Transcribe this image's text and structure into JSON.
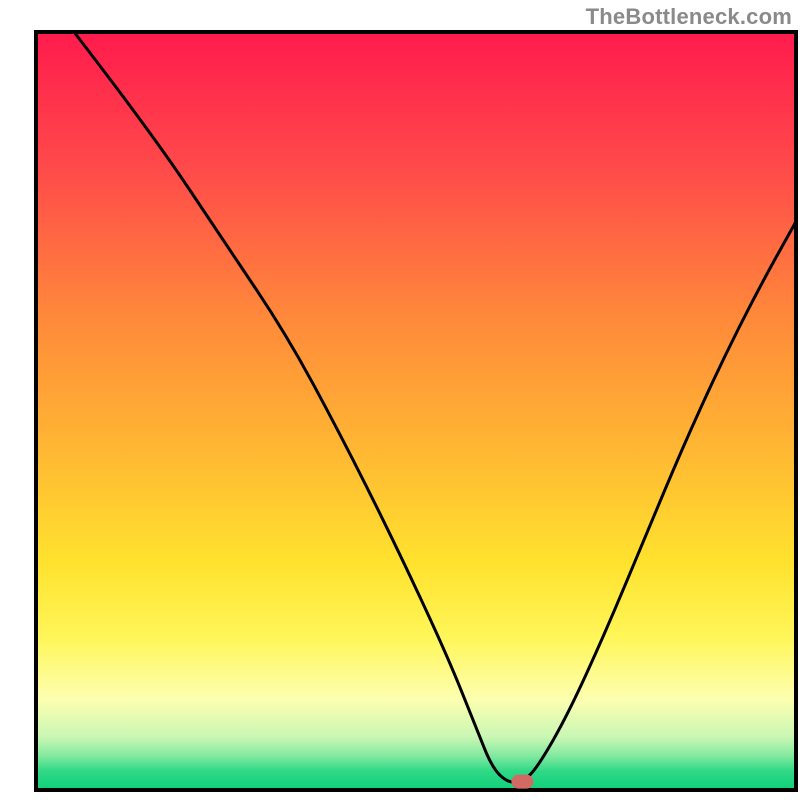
{
  "attribution": "TheBottleneck.com",
  "chart_data": {
    "type": "line",
    "title": "",
    "xlabel": "",
    "ylabel": "",
    "xlim": [
      0,
      100
    ],
    "ylim": [
      0,
      100
    ],
    "grid": false,
    "legend": false,
    "series": [
      {
        "name": "curve",
        "x": [
          5,
          15,
          25,
          33,
          40,
          47,
          54,
          58,
          60,
          62,
          64,
          66,
          70,
          75,
          80,
          85,
          90,
          95,
          100
        ],
        "y": [
          100,
          87,
          72,
          60,
          47,
          33,
          18,
          8,
          3,
          1,
          1,
          3,
          10,
          21,
          33,
          45,
          56,
          66,
          75
        ]
      }
    ],
    "marker": {
      "x_fraction": 0.64,
      "y_fraction": 0.011,
      "color": "#d16a62"
    },
    "gradient_stops": [
      {
        "offset": 0.0,
        "color": "#ff1b4d"
      },
      {
        "offset": 0.18,
        "color": "#ff4a4a"
      },
      {
        "offset": 0.38,
        "color": "#ff8a3a"
      },
      {
        "offset": 0.55,
        "color": "#ffb733"
      },
      {
        "offset": 0.7,
        "color": "#ffe22e"
      },
      {
        "offset": 0.8,
        "color": "#fff65a"
      },
      {
        "offset": 0.88,
        "color": "#fdffb0"
      },
      {
        "offset": 0.93,
        "color": "#c9f7b4"
      },
      {
        "offset": 0.955,
        "color": "#83e9a0"
      },
      {
        "offset": 0.975,
        "color": "#2fd986"
      },
      {
        "offset": 1.0,
        "color": "#0fd07a"
      }
    ],
    "frame_color": "#000000",
    "curve_color": "#000000"
  }
}
